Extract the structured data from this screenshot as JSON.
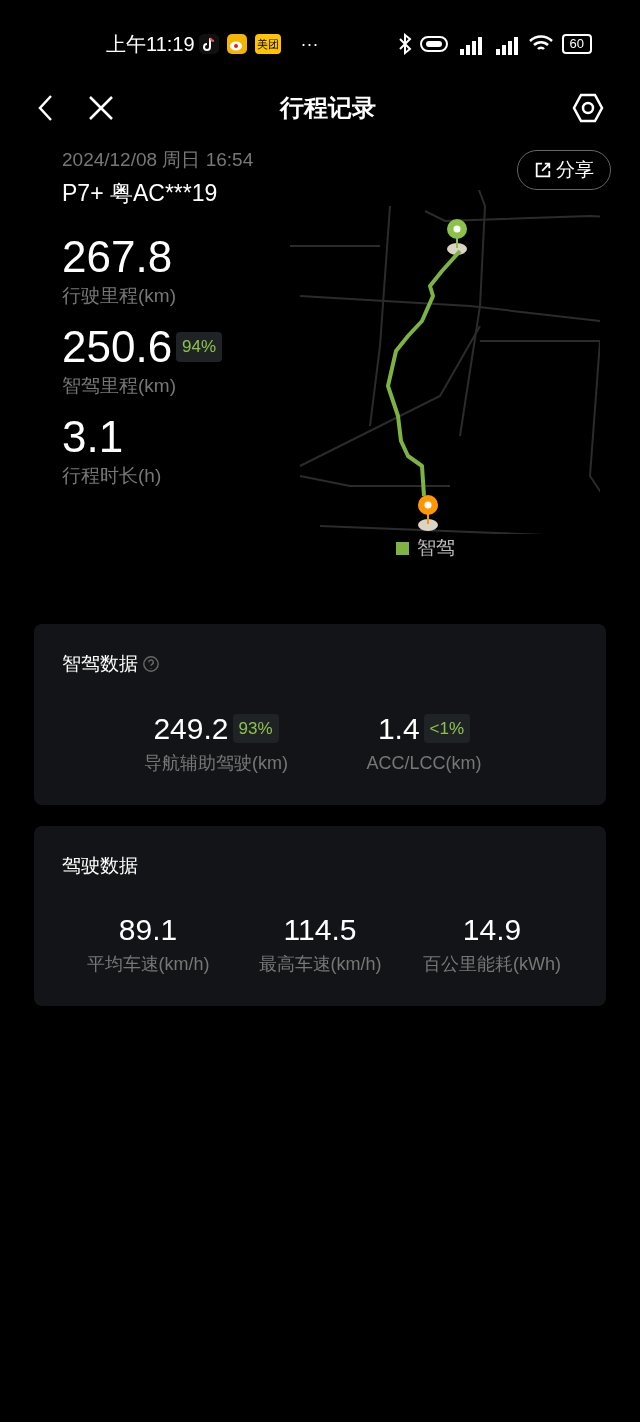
{
  "status_bar": {
    "time": "上午11:19",
    "app_badge": "美团",
    "more": "···",
    "battery": "60"
  },
  "header": {
    "title": "行程记录"
  },
  "trip": {
    "datetime": "2024/12/08 周日 16:54",
    "vehicle": "P7+ 粤AC***19",
    "share": "分享",
    "stats": [
      {
        "value": "267.8",
        "label": "行驶里程(km)"
      },
      {
        "value": "250.6",
        "badge": "94%",
        "label": "智驾里程(km)"
      },
      {
        "value": "3.1",
        "label": "行程时长(h)"
      }
    ],
    "legend": {
      "label": "智驾",
      "color": "#7cb342"
    }
  },
  "cards": [
    {
      "title": "智驾数据",
      "help": true,
      "items": [
        {
          "value": "249.2",
          "badge": "93%",
          "label": "导航辅助驾驶(km)"
        },
        {
          "value": "1.4",
          "badge": "<1%",
          "label": "ACC/LCC(km)"
        }
      ]
    },
    {
      "title": "驾驶数据",
      "help": false,
      "items": [
        {
          "value": "89.1",
          "label": "平均车速(km/h)"
        },
        {
          "value": "114.5",
          "label": "最高车速(km/h)"
        },
        {
          "value": "14.9",
          "label": "百公里能耗(kWh)"
        }
      ]
    }
  ]
}
